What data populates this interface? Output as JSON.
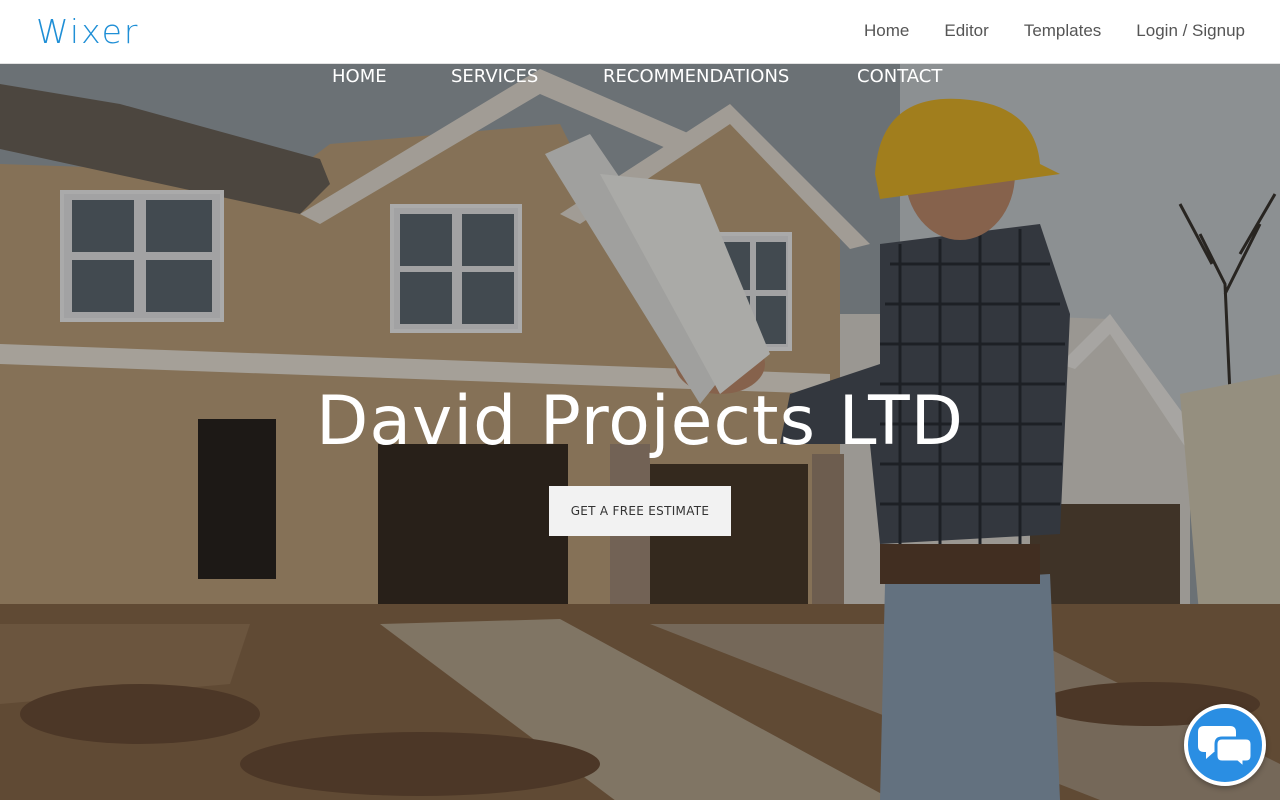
{
  "topbar": {
    "logo": "Wixer",
    "nav": [
      "Home",
      "Editor",
      "Templates",
      "Login / Signup"
    ]
  },
  "site": {
    "nav": [
      "HOME",
      "SERVICES",
      "RECOMMENDATIONS",
      "CONTACT"
    ],
    "headline": "David Projects LTD",
    "cta_label": "GET A FREE ESTIMATE"
  },
  "colors": {
    "brand": "#1f8fd6",
    "chat": "#2a8ee3"
  },
  "icons": {
    "chat": "chat-bubbles-icon"
  }
}
